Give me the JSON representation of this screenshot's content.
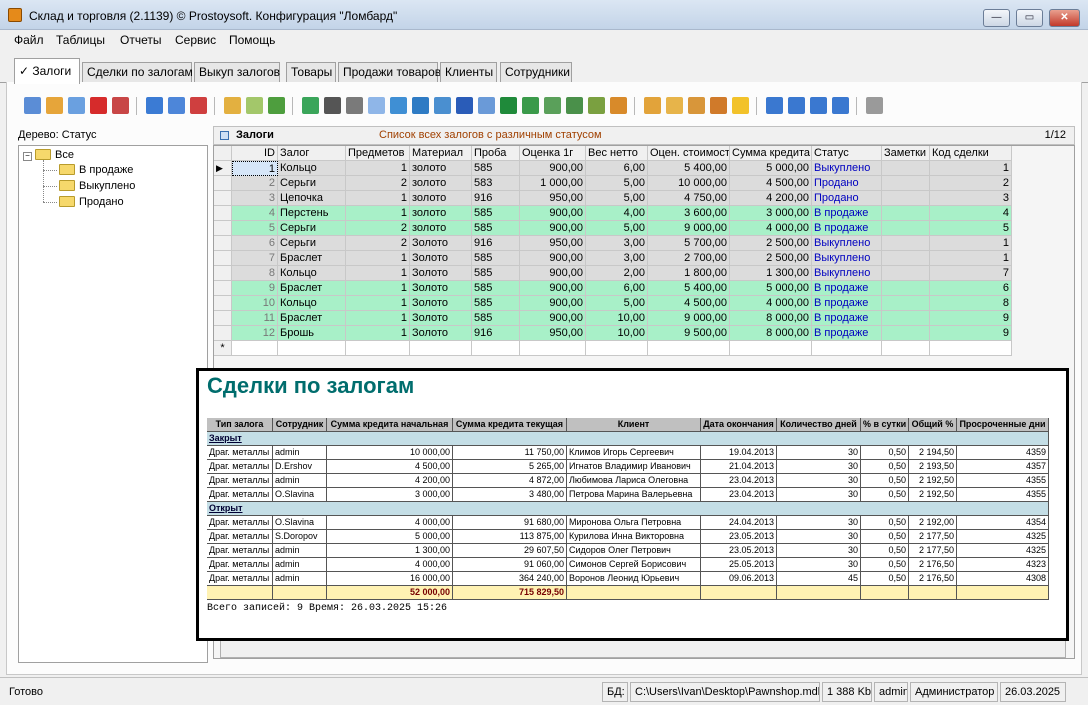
{
  "window": {
    "title": "Склад и торговля (2.1139) © Prostoysoft. Конфигурация \"Ломбард\""
  },
  "menu": [
    "Файл",
    "Таблицы",
    "Отчеты",
    "Сервис",
    "Помощь"
  ],
  "tabs": [
    "✓ Залоги",
    "Сделки по залогам",
    "Выкуп залогов",
    "Товары",
    "Продажи товаров",
    "Клиенты",
    "Сотрудники"
  ],
  "tree": {
    "caption": "Дерево: Статус",
    "items": [
      "Все",
      "В продаже",
      "Выкуплено",
      "Продано"
    ]
  },
  "grid": {
    "title": "Залоги",
    "subtitle": "Список всех залогов с различным статусом",
    "counter": "1/12",
    "columns": [
      "ID",
      "Залог",
      "Предметов",
      "Материал",
      "Проба",
      "Оценка 1г",
      "Вес нетто",
      "Оцен. стоимость",
      "Сумма кредита",
      "Статус",
      "Заметки",
      "Код сделки"
    ],
    "rows": [
      [
        "1",
        "Кольцо",
        "1",
        "золото",
        "585",
        "900,00",
        "6,00",
        "5 400,00",
        "5 000,00",
        "Выкуплено",
        "",
        "1"
      ],
      [
        "2",
        "Серьги",
        "2",
        "золото",
        "583",
        "1 000,00",
        "5,00",
        "10 000,00",
        "4 500,00",
        "Продано",
        "",
        "2"
      ],
      [
        "3",
        "Цепочка",
        "1",
        "золото",
        "916",
        "950,00",
        "5,00",
        "4 750,00",
        "4 200,00",
        "Продано",
        "",
        "3"
      ],
      [
        "4",
        "Перстень",
        "1",
        "золото",
        "585",
        "900,00",
        "4,00",
        "3 600,00",
        "3 000,00",
        "В продаже",
        "",
        "4"
      ],
      [
        "5",
        "Серьги",
        "2",
        "золото",
        "585",
        "900,00",
        "5,00",
        "9 000,00",
        "4 000,00",
        "В продаже",
        "",
        "5"
      ],
      [
        "6",
        "Серьги",
        "2",
        "Золото",
        "916",
        "950,00",
        "3,00",
        "5 700,00",
        "2 500,00",
        "Выкуплено",
        "",
        "1"
      ],
      [
        "7",
        "Браслет",
        "1",
        "Золото",
        "585",
        "900,00",
        "3,00",
        "2 700,00",
        "2 500,00",
        "Выкуплено",
        "",
        "1"
      ],
      [
        "8",
        "Кольцо",
        "1",
        "Золото",
        "585",
        "900,00",
        "2,00",
        "1 800,00",
        "1 300,00",
        "Выкуплено",
        "",
        "7"
      ],
      [
        "9",
        "Браслет",
        "1",
        "Золото",
        "585",
        "900,00",
        "6,00",
        "5 400,00",
        "5 000,00",
        "В продаже",
        "",
        "6"
      ],
      [
        "10",
        "Кольцо",
        "1",
        "Золото",
        "585",
        "900,00",
        "5,00",
        "4 500,00",
        "4 000,00",
        "В продаже",
        "",
        "8"
      ],
      [
        "11",
        "Браслет",
        "1",
        "Золото",
        "585",
        "900,00",
        "10,00",
        "9 000,00",
        "8 000,00",
        "В продаже",
        "",
        "9"
      ],
      [
        "12",
        "Брошь",
        "1",
        "Золото",
        "916",
        "950,00",
        "10,00",
        "9 500,00",
        "8 000,00",
        "В продаже",
        "",
        "9"
      ]
    ],
    "row_colors": {
      "sold": "#dcdcdc",
      "on_sale": "#a8f0c8",
      "selected": "#d6e6f8"
    },
    "new_row_marker": "*"
  },
  "report": {
    "title": "Сделки по залогам",
    "columns": [
      "Тип залога",
      "Сотрудник",
      "Сумма кредита начальная",
      "Сумма кредита текущая",
      "Клиент",
      "Дата окончания",
      "Количество дней",
      "% в сутки",
      "Общий %",
      "Просроченные дни"
    ],
    "groups": [
      {
        "name": "Закрыт",
        "rows": [
          [
            "Драг. металлы",
            "admin",
            "10 000,00",
            "11 750,00",
            "Климов Игорь Сергеевич",
            "19.04.2013",
            "30",
            "0,50",
            "2 194,50",
            "4359"
          ],
          [
            "Драг. металлы",
            "D.Ershov",
            "4 500,00",
            "5 265,00",
            "Игнатов Владимир Иванович",
            "21.04.2013",
            "30",
            "0,50",
            "2 193,50",
            "4357"
          ],
          [
            "Драг. металлы",
            "admin",
            "4 200,00",
            "4 872,00",
            "Любимова Лариса Олеговна",
            "23.04.2013",
            "30",
            "0,50",
            "2 192,50",
            "4355"
          ],
          [
            "Драг. металлы",
            "O.Slavina",
            "3 000,00",
            "3 480,00",
            "Петрова Марина Валерьевна",
            "23.04.2013",
            "30",
            "0,50",
            "2 192,50",
            "4355"
          ]
        ]
      },
      {
        "name": "Открыт",
        "rows": [
          [
            "Драг. металлы",
            "O.Slavina",
            "4 000,00",
            "91 680,00",
            "Миронова Ольга Петровна",
            "24.04.2013",
            "30",
            "0,50",
            "2 192,00",
            "4354"
          ],
          [
            "Драг. металлы",
            "S.Doropov",
            "5 000,00",
            "113 875,00",
            "Курилова Инна Викторовна",
            "23.05.2013",
            "30",
            "0,50",
            "2 177,50",
            "4325"
          ],
          [
            "Драг. металлы",
            "admin",
            "1 300,00",
            "29 607,50",
            "Сидоров Олег Петрович",
            "23.05.2013",
            "30",
            "0,50",
            "2 177,50",
            "4325"
          ],
          [
            "Драг. металлы",
            "admin",
            "4 000,00",
            "91 060,00",
            "Симонов Сергей Борисович",
            "25.05.2013",
            "30",
            "0,50",
            "2 176,50",
            "4323"
          ],
          [
            "Драг. металлы",
            "admin",
            "16 000,00",
            "364 240,00",
            "Воронов Леонид Юрьевич",
            "09.06.2013",
            "45",
            "0,50",
            "2 176,50",
            "4308"
          ]
        ]
      }
    ],
    "totals": [
      "",
      "",
      "52 000,00",
      "715 829,50",
      "",
      "",
      "",
      "",
      "",
      ""
    ],
    "footer": "Всего записей: 9   Время: 26.03.2025 15:26"
  },
  "status": {
    "ready": "Готово",
    "db_label": "БД:",
    "db_path": "C:\\Users\\Ivan\\Desktop\\Pawnshop.mdb",
    "size": "1 388 Kb",
    "user": "admin",
    "role": "Администратор",
    "date": "26.03.2025"
  },
  "colors": {
    "accent": "#006d6d",
    "status_text": "#0000c0"
  }
}
